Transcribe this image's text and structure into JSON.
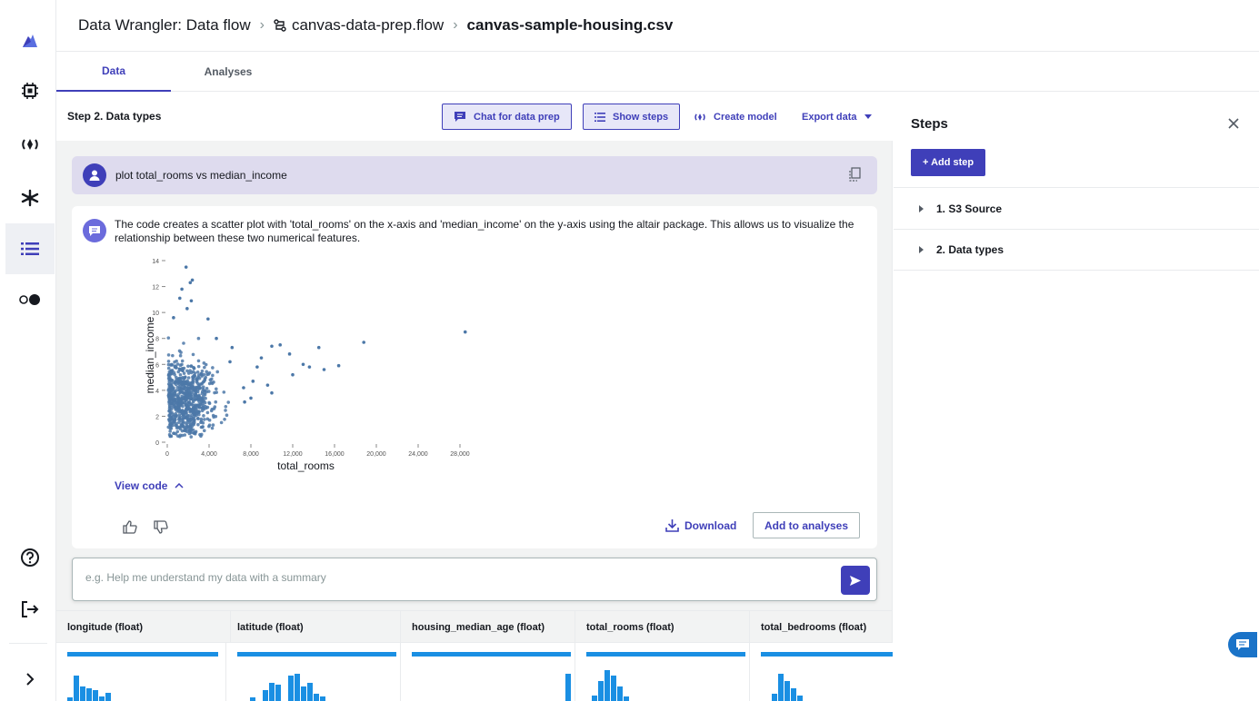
{
  "header": {
    "crumb_root": "Data Wrangler: Data flow",
    "crumb_flow": "canvas-data-prep.flow",
    "crumb_file": "canvas-sample-housing.csv"
  },
  "tabs": [
    {
      "label": "Data",
      "active": true
    },
    {
      "label": "Analyses",
      "active": false
    }
  ],
  "toolbar": {
    "title": "Step 2. Data types",
    "chat_label": "Chat for data prep",
    "show_steps_label": "Show steps",
    "create_model_label": "Create model",
    "export_label": "Export data"
  },
  "prompt": {
    "text": "plot total_rooms vs median_income"
  },
  "answer": {
    "text": "The code creates a scatter plot with 'total_rooms' on the x-axis and 'median_income' on the y-axis using the altair package. This allows us to visualize the relationship between these two numerical features.",
    "view_code_label": "View code",
    "download_label": "Download",
    "add_analyses_label": "Add to analyses"
  },
  "chat_input": {
    "placeholder": "e.g. Help me understand my data with a summary",
    "value": ""
  },
  "chart_data": {
    "type": "scatter",
    "xlabel": "total_rooms",
    "ylabel": "median_income",
    "x_ticks": [
      "0",
      "4,000",
      "8,000",
      "12,000",
      "16,000",
      "20,000",
      "24,000",
      "28,000"
    ],
    "y_ticks": [
      "0",
      "2",
      "4",
      "6",
      "8",
      "10",
      "12",
      "14"
    ],
    "xlim": [
      0,
      30000
    ],
    "ylim": [
      0,
      14
    ],
    "point_color": "#4c78a8",
    "outliers": [
      {
        "x": 1800,
        "y": 13.5
      },
      {
        "x": 2200,
        "y": 12.3
      },
      {
        "x": 2400,
        "y": 12.5
      },
      {
        "x": 1400,
        "y": 11.8
      },
      {
        "x": 1200,
        "y": 11.1
      },
      {
        "x": 2300,
        "y": 10.9
      },
      {
        "x": 1900,
        "y": 10.3
      },
      {
        "x": 600,
        "y": 9.6
      },
      {
        "x": 28500,
        "y": 8.5
      },
      {
        "x": 18800,
        "y": 7.7
      },
      {
        "x": 14500,
        "y": 7.3
      },
      {
        "x": 10000,
        "y": 7.4
      },
      {
        "x": 10800,
        "y": 7.5
      },
      {
        "x": 11700,
        "y": 6.8
      },
      {
        "x": 13000,
        "y": 6.0
      },
      {
        "x": 13600,
        "y": 5.8
      },
      {
        "x": 15000,
        "y": 5.6
      },
      {
        "x": 16400,
        "y": 5.9
      },
      {
        "x": 12000,
        "y": 5.2
      },
      {
        "x": 8600,
        "y": 5.8
      },
      {
        "x": 9000,
        "y": 6.5
      },
      {
        "x": 8200,
        "y": 4.7
      },
      {
        "x": 9600,
        "y": 4.4
      },
      {
        "x": 10000,
        "y": 3.8
      },
      {
        "x": 7300,
        "y": 4.2
      },
      {
        "x": 8000,
        "y": 3.4
      },
      {
        "x": 7400,
        "y": 3.1
      },
      {
        "x": 6000,
        "y": 6.2
      },
      {
        "x": 6200,
        "y": 7.3
      },
      {
        "x": 4700,
        "y": 8.0
      },
      {
        "x": 3900,
        "y": 9.5
      }
    ],
    "cluster": {
      "x_center": 1800,
      "y_center": 3.4,
      "x_spread": 1400,
      "y_spread": 1.6,
      "count": 700
    }
  },
  "table": {
    "columns": [
      {
        "label": "longitude (float)",
        "bars": [
          4,
          28,
          16,
          14,
          12,
          5,
          9
        ]
      },
      {
        "label": "latitude (float)",
        "bars": [
          0,
          0,
          4,
          0,
          12,
          20,
          18,
          0,
          28,
          30,
          16,
          20,
          8,
          5
        ]
      },
      {
        "label": "housing_median_age (float)",
        "bars": [
          30
        ]
      },
      {
        "label": "total_rooms (float)",
        "bars": [
          6,
          22,
          34,
          28,
          16,
          5
        ]
      },
      {
        "label": "total_bedrooms (float)",
        "bars": [
          8,
          30,
          22,
          14,
          6
        ]
      }
    ]
  },
  "steps_panel": {
    "title": "Steps",
    "add_step_label": "+ Add step",
    "items": [
      "1. S3 Source",
      "2. Data types"
    ]
  },
  "colors": {
    "accent": "#3f3fb9",
    "prompt_bg": "#dedbee",
    "histogram": "#1a8fe3"
  }
}
